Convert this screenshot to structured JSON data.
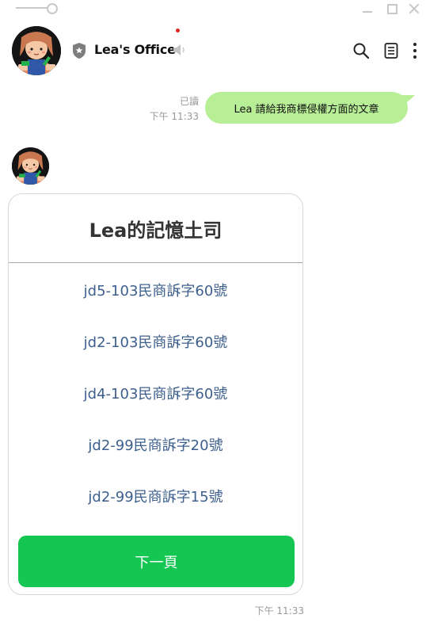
{
  "window": {
    "controls": [
      "minimize-icon",
      "maximize-icon",
      "close-icon"
    ]
  },
  "header": {
    "title": "Lea's Office",
    "icons": [
      "shield-icon",
      "mute-icon",
      "search-icon",
      "notes-icon",
      "more-icon"
    ],
    "notification_color": "#e0241b"
  },
  "messages": {
    "sent": {
      "text": "Lea 請給我商標侵權方面的文章",
      "read_label": "已讀",
      "time": "下午 11:33",
      "bubble_color": "#b7ee96"
    },
    "received": {
      "time": "下午 11:33",
      "card": {
        "title": "Lea的記憶土司",
        "links": [
          "jd5-103民商訴字60號",
          "jd2-103民商訴字60號",
          "jd4-103民商訴字60號",
          "jd2-99民商訴字20號",
          "jd2-99民商訴字15號"
        ],
        "button_label": "下一頁",
        "button_color": "#16c653"
      }
    }
  }
}
